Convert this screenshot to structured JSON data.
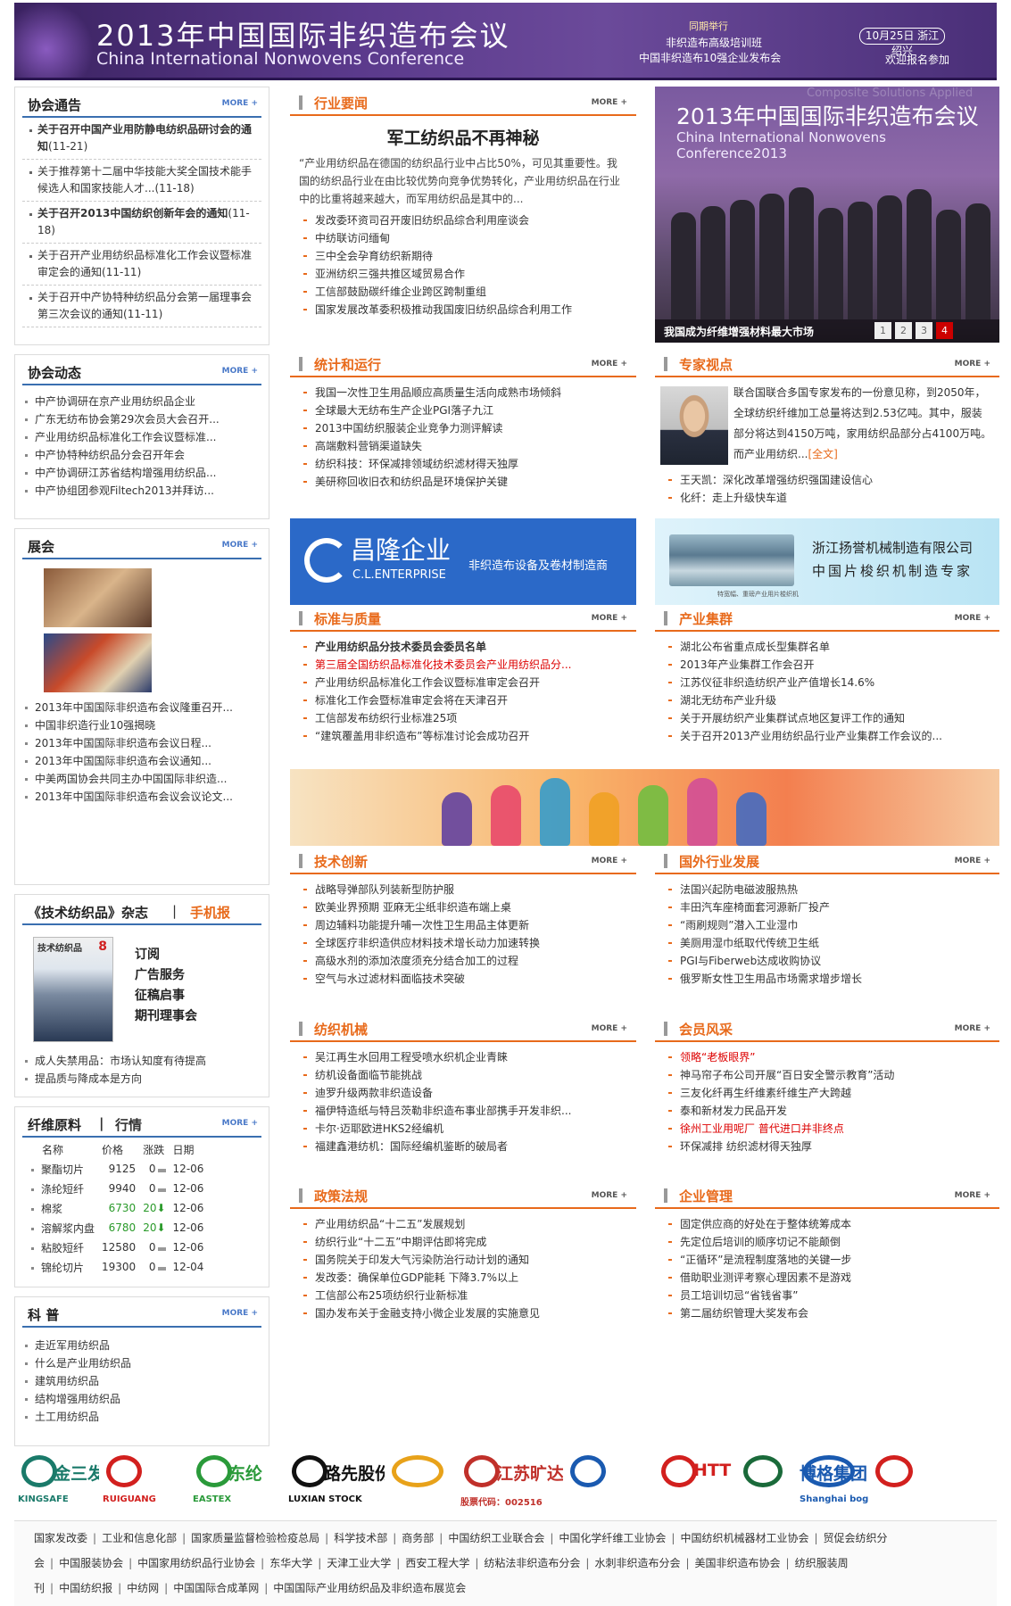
{
  "banner": {
    "title_cn": "2013年中国国际非织造布会议",
    "title_en": "China International Nonwovens Conference",
    "tag": "同期举行",
    "sub1": "非织造布高级培训班",
    "sub2": "中国非织造布10强企业发布会",
    "date": "10月25日  浙江绍兴",
    "join": "欢迎报名参加"
  },
  "more": "MORE +",
  "notice": {
    "title": "协会通告",
    "items": [
      {
        "t": "关于召开中国产业用防静电纺织品研讨会的通知",
        "d": "(11-21)",
        "bold": true
      },
      {
        "t": "关于推荐第十二届中华技能大奖全国技术能手候选人和国家技能人才...",
        "d": "(11-18)",
        "bold": false
      },
      {
        "t": "关于召开2013中国纺织创新年会的通知",
        "d": "(11-18)",
        "bold": true
      },
      {
        "t": "关于召开产业用纺织品标准化工作会议暨标准审定会的通知",
        "d": "(11-11)",
        "bold": false
      },
      {
        "t": "关于召开中产协特种纺织品分会第一届理事会第三次会议的通知",
        "d": "(11-11)",
        "bold": false
      }
    ]
  },
  "dynamics": {
    "title": "协会动态",
    "items": [
      "中产协调研在京产业用纺织品企业",
      "广东无纺布协会第29次会员大会召开...",
      "产业用纺织品标准化工作会议暨标准...",
      "中产协特种纺织品分会召开年会",
      "中产协调研江苏省结构增强用纺织品...",
      "中产协组团参观Filtech2013并拜访..."
    ]
  },
  "expo": {
    "title": "展会",
    "items": [
      "2013年中国国际非织造布会议隆重召开...",
      "中国非织造行业10强揭晓",
      "2013年中国国际非织造布会议日程...",
      "2013年中国国际非织造布会议通知...",
      "中美两国协会共同主办中国国际非织造...",
      "2013年中国国际非织造布会议会议论文..."
    ]
  },
  "mag": {
    "title": "《技术纺织品》杂志",
    "sep": "|",
    "mobile": "手机报",
    "cover_title": "技术纺织品",
    "cover_num": "8",
    "links": [
      "订阅",
      "广告服务",
      "征稿启事",
      "期刊理事会"
    ],
    "items": [
      "成人失禁用品：市场认知度有待提高",
      "提品质与降成本是方向"
    ]
  },
  "market": {
    "title": "纤维原料",
    "sep": "|",
    "title2": "行情",
    "cols": [
      "名称",
      "价格",
      "涨跌",
      "日期"
    ],
    "rows": [
      [
        "聚酯切片",
        "9125",
        "0",
        "12-06",
        "flat"
      ],
      [
        "涤纶短纤",
        "9940",
        "0",
        "12-06",
        "flat"
      ],
      [
        "棉浆",
        "6730",
        "20",
        "12-06",
        "down"
      ],
      [
        "溶解浆内盘",
        "6780",
        "20",
        "12-06",
        "down"
      ],
      [
        "粘胶短纤",
        "12580",
        "0",
        "12-06",
        "flat"
      ],
      [
        "锦纶切片",
        "19300",
        "0",
        "12-04",
        "flat"
      ]
    ]
  },
  "science": {
    "title": "科  普",
    "items": [
      "走近军用纺织品",
      "什么是产业用纺织品",
      "建筑用纺织品",
      "结构增强用纺织品",
      "土工用纺织品"
    ]
  },
  "news": {
    "title": "行业要闻",
    "headline": "军工纺织品不再神秘",
    "summary": "“产业用纺织品在德国的纺织品行业中占比50%，可见其重要性。我国的纺织品行业在由比较优势向竞争优势转化，产业用纺织品在行业中的比重将越来越大，而军用纺织品是其中的...",
    "items": [
      "发改委环资司召开废旧纺织品综合利用座谈会",
      "中纺联访问缅甸",
      "三中全会孕育纺织新期待",
      "亚洲纺织三强共推区域贸易合作",
      "工信部鼓励碳纤维企业跨区跨制重组",
      "国家发展改革委积极推动我国废旧纺织品综合利用工作"
    ]
  },
  "photo": {
    "h1": "2013年中国国际非织造布会议",
    "h2": "China International Nonwovens Conference2013",
    "watermark": "Composite Solutions Applied",
    "caption": "我国成为纤维增强材料最大市场",
    "pages": [
      "1",
      "2",
      "3",
      "4"
    ]
  },
  "stats": {
    "title": "统计和运行",
    "items": [
      "我国一次性卫生用品顺应高质量生活向成熟市场倾斜",
      "全球最大无纺布生产企业PGI落子九江",
      "2013中国纺织服装企业竞争力测评解读",
      "高端敷料营销渠道缺失",
      "纺织科技：环保减排领域纺织滤材得天独厚",
      "美研称回收旧衣和纺织品是环境保护关键"
    ]
  },
  "expert": {
    "title": "专家视点",
    "summary": "联合国联合多国专家发布的一份意见称，到2050年，全球纺织纤维加工总量将达到2.53亿吨。其中，服装部分将达到4150万吨，家用纺织品部分占4100万吨。而产业用纺织...",
    "full": "[全文]",
    "items": [
      "王天凯：深化改革增强纺织强国建设信心",
      "化纤：走上升级快车道"
    ]
  },
  "ad1": {
    "cn": "昌隆企业",
    "en": "C.L.ENTERPRISE",
    "slogan": "非织造布设备及卷材制造商"
  },
  "ad2": {
    "name": "浙江扬誉机械制造有限公司",
    "slogan": "中国片梭织机制造专家",
    "small": "特宽幅、重磅产业用片梭织机"
  },
  "standard": {
    "title": "标准与质量",
    "items": [
      {
        "t": "产业用纺织品分技术委员会委员名单",
        "c": "bold"
      },
      {
        "t": "第三届全国纺织品标准化技术委员会产业用纺织品分...",
        "c": "red"
      },
      {
        "t": "产业用纺织品标准化工作会议暨标准审定会召开",
        "c": ""
      },
      {
        "t": "标准化工作会暨标准审定会将在天津召开",
        "c": ""
      },
      {
        "t": "工信部发布纺织行业标准25项",
        "c": ""
      },
      {
        "t": "“建筑覆盖用非织造布”等标准讨论会成功召开",
        "c": ""
      }
    ]
  },
  "cluster": {
    "title": "产业集群",
    "items": [
      "湖北公布省重点成长型集群名单",
      "2013年产业集群工作会召开",
      "江苏仪征非织造纺织产业产值增长14.6%",
      "湖北无纺布产业升级",
      "关于开展纺织产业集群试点地区复评工作的通知",
      "关于召开2013产业用纺织品行业产业集群工作会议的..."
    ]
  },
  "tech": {
    "title": "技术创新",
    "items": [
      "战略导弹部队列装新型防护服",
      "欧美业界预期 亚麻无尘纸非织造布端上桌",
      "周边辅料功能提升哺一次性卫生用品主体更新",
      "全球医疗非织造供应材料技术增长动力加速转换",
      "高级水剂的添加浓度须充分结合加工的过程",
      "空气与水过滤材料面临技术突破"
    ]
  },
  "foreign": {
    "title": "国外行业发展",
    "items": [
      "法国兴起防电磁波服热热",
      "丰田汽车座椅面套河源新厂投产",
      "“雨刷规则”潜入工业湿巾",
      "美厕用湿巾纸取代传统卫生纸",
      "PGI与Fiberweb达成收购协议",
      "俄罗斯女性卫生用品市场需求增步增长"
    ]
  },
  "machine": {
    "title": "纺织机械",
    "items": [
      "吴江再生水回用工程受喷水织机企业青睐",
      "纺机设备面临节能挑战",
      "迪罗升级两款非织造设备",
      "福伊特造纸与特吕茨勒非织造布事业部携手开发非织...",
      "卡尔·迈耶欧进HKS2经编机",
      "福建鑫港纺机：国际经编机鉴断的破局者"
    ]
  },
  "member": {
    "title": "会员风采",
    "items": [
      {
        "t": "领略“老板眼界”",
        "c": "red"
      },
      {
        "t": "神马帘子布公司开展“百日安全警示教育”活动",
        "c": ""
      },
      {
        "t": "三友化纤再生纤维素纤维生产大跨越",
        "c": ""
      },
      {
        "t": "泰和新材发力民品开发",
        "c": ""
      },
      {
        "t": "徐州工业用呢厂 普代进口并非终点",
        "c": "red"
      },
      {
        "t": "环保减排 纺织滤材得天独厚",
        "c": ""
      }
    ]
  },
  "policy": {
    "title": "政策法规",
    "items": [
      "产业用纺织品“十二五”发展规划",
      "纺织行业“十二五”中期评估即将完成",
      "国务院关于印发大气污染防治行动计划的通知",
      "发改委：确保单位GDP能耗 下降3.7%以上",
      "工信部公布25项纺织行业新标准",
      "国办发布关于金融支持小微企业发展的实施意见"
    ]
  },
  "manage": {
    "title": "企业管理",
    "items": [
      "固定供应商的好处在于整体统筹成本",
      "先定位后培训的顺序切记不能颠倒",
      "“正循环”是流程制度落地的关键一步",
      "借助职业测评考察心理因素不是游戏",
      "员工培训切忌“省钱省事”",
      "第二届纺织管理大奖发布会"
    ]
  },
  "logos": [
    {
      "name": "金三发集团",
      "sub": "KINGSAFE",
      "color": "#1a7a6a"
    },
    {
      "name": "",
      "sub": "RUIGUANG",
      "color": "#d2201e"
    },
    {
      "name": "东纶",
      "sub": "EASTEX",
      "color": "#2a9a3a"
    },
    {
      "name": "路先股份",
      "sub": "LUXIAN  STOCK",
      "color": "#111"
    },
    {
      "name": "",
      "sub": "",
      "color": "#e8a21a"
    },
    {
      "name": "江苏旷达",
      "sub": "股票代码：002516",
      "color": "#c0302a"
    },
    {
      "name": "",
      "sub": "",
      "color": "#1a5ab0"
    },
    {
      "name": "HTT",
      "sub": "",
      "color": "#d2201e"
    },
    {
      "name": "",
      "sub": "",
      "color": "#1a6a3a"
    },
    {
      "name": "博格集团",
      "sub": "Shanghai boge group",
      "color": "#1a5ab0"
    },
    {
      "name": "",
      "sub": "",
      "color": "#d2201e"
    }
  ],
  "links": [
    [
      "国家发改委",
      "工业和信息化部",
      "国家质量监督检验检疫总局",
      "科学技术部",
      "商务部",
      "中国纺织工业联合会",
      "中国化学纤维工业协会",
      "中国纺织机械器材工业协会",
      "贸促会纺织分"
    ],
    [
      "会",
      "中国服装协会",
      "中国家用纺织品行业协会",
      "东华大学",
      "天津工业大学",
      "西安工程大学",
      "纺粘法非织造布分会",
      "水刺非织造布分会",
      "美国非织造布协会",
      "纺织服装周"
    ],
    [
      "刊",
      "中国纺织报",
      "中纺网",
      "中国国际合成革网",
      "中国国际产业用纺织品及非织造布展览会"
    ]
  ]
}
